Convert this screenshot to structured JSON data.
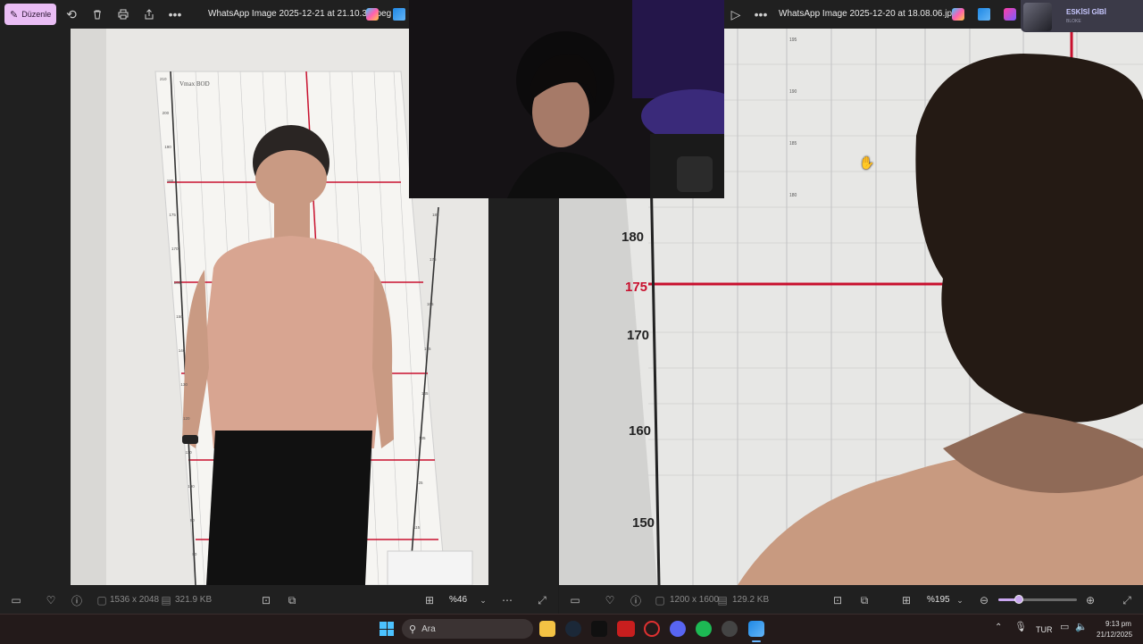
{
  "left_viewer": {
    "edit_label": "Düzenle",
    "filename": "WhatsApp Image 2025-12-21 at 21.10.36.jpeg",
    "dimensions": "1536 x 2048",
    "file_size": "321.9 KB",
    "zoom": "%46",
    "chart_overlay": {
      "brand": "Vmax BOD",
      "ticks_left": [
        "210",
        "200",
        "190",
        "180",
        "175",
        "170",
        "160",
        "150",
        "140",
        "130",
        "120",
        "110",
        "100",
        "90",
        "80"
      ],
      "ticks_right": [
        "185",
        "175",
        "165",
        "155",
        "145",
        "135",
        "125",
        "115"
      ]
    }
  },
  "right_viewer": {
    "filename": "WhatsApp Image 2025-12-20 at 18.08.06.jpeg",
    "dimensions": "1200 x 1600",
    "file_size": "129.2 KB",
    "zoom": "%195",
    "big_ticks": [
      "180",
      "175",
      "170",
      "160",
      "150"
    ],
    "small_ticks_top": [
      "195",
      "190",
      "185",
      "180"
    ]
  },
  "overlay_profile": {
    "name": "ESKİSİ GİBİ",
    "sub": "BLOKE"
  },
  "taskbar": {
    "search_placeholder": "Ara",
    "language": "TUR",
    "time": "9:13 pm",
    "date": "21/12/2025"
  },
  "colors": {
    "accent": "#e9bdf4",
    "accent_text": "#2b1633",
    "chart_red": "#c8102e",
    "taskbar": "#231a1a"
  }
}
